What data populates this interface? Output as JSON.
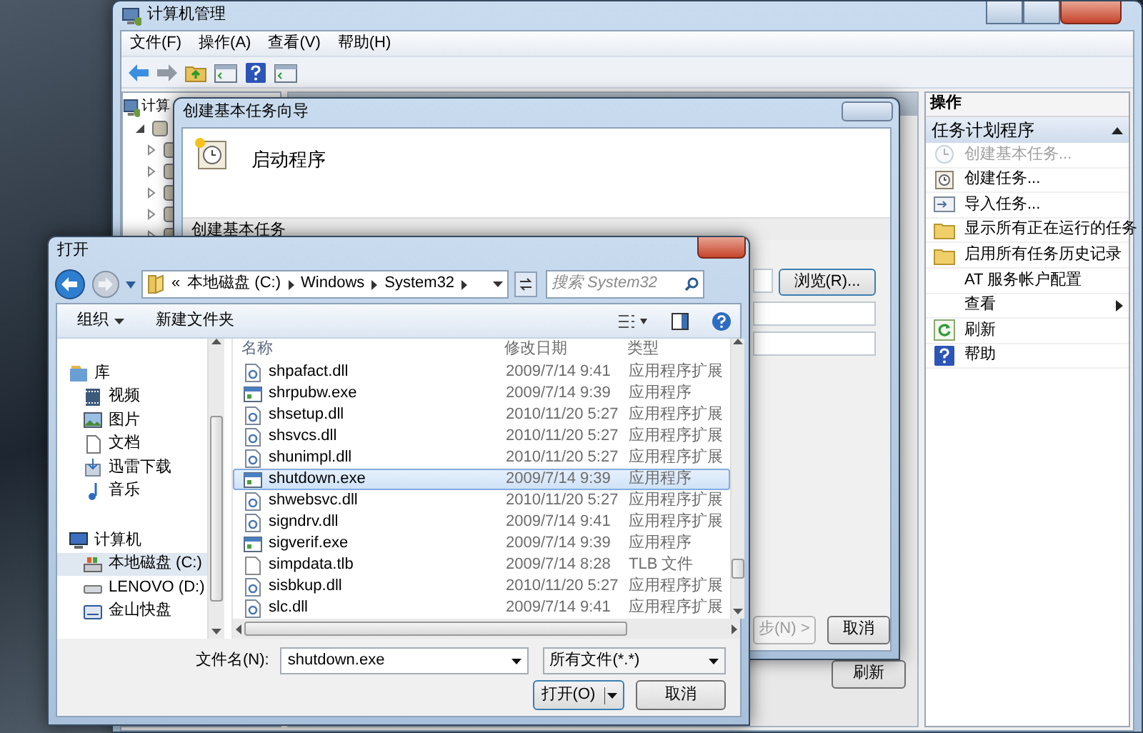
{
  "main_window": {
    "title": "计算机管理",
    "menu": [
      "文件(F)",
      "操作(A)",
      "查看(V)",
      "帮助(H)"
    ],
    "tree": {
      "label": "计算",
      "children": [
        {
          "expanded": true,
          "children": [
            {
              "expanded": false
            },
            {
              "expanded": false
            },
            {
              "expanded": false
            },
            {
              "expanded": false
            },
            {
              "expanded": false
            }
          ]
        }
      ]
    },
    "actions": {
      "title": "操作",
      "section": {
        "label": "任务计划程序",
        "expanded": true
      },
      "items": [
        {
          "label": "创建基本任务...",
          "disabled": true,
          "submenu": false
        },
        {
          "label": "创建任务...",
          "disabled": false,
          "submenu": false
        },
        {
          "label": "导入任务...",
          "disabled": false,
          "submenu": false
        },
        {
          "label": "显示所有正在运行的任务",
          "disabled": false,
          "submenu": false
        },
        {
          "label": "启用所有任务历史记录",
          "disabled": false,
          "submenu": false
        },
        {
          "label": "AT 服务帐户配置",
          "disabled": false,
          "submenu": false
        },
        {
          "label": "查看",
          "disabled": false,
          "submenu": true
        },
        {
          "label": "刷新",
          "disabled": false,
          "submenu": false
        },
        {
          "label": "帮助",
          "disabled": false,
          "submenu": false
        }
      ]
    },
    "refresh_button": "刷新"
  },
  "wizard": {
    "title": "创建基本任务向导",
    "heading": "启动程序",
    "step": "创建基本任务",
    "browse_button": "浏览(R)...",
    "next_button": {
      "label": "步(N) >",
      "disabled": true
    },
    "cancel_button": "取消"
  },
  "open_dialog": {
    "title": "打开",
    "path": {
      "overflow": "«",
      "crumbs": [
        "本地磁盘 (C:)",
        "Windows",
        "System32"
      ]
    },
    "search": {
      "placeholder": "搜索 System32"
    },
    "toolbar": [
      {
        "label": "组织",
        "dropdown": true
      },
      {
        "label": "新建文件夹",
        "dropdown": false
      }
    ],
    "nav": [
      {
        "label": "库",
        "selected": false,
        "children": [
          {
            "label": "视频",
            "selected": false
          },
          {
            "label": "图片",
            "selected": false
          },
          {
            "label": "文档",
            "selected": false
          },
          {
            "label": "迅雷下载",
            "selected": false
          },
          {
            "label": "音乐",
            "selected": false
          }
        ]
      },
      {
        "label": "计算机",
        "selected": false,
        "children": [
          {
            "label": "本地磁盘 (C:)",
            "selected": true
          },
          {
            "label": "LENOVO (D:)",
            "selected": false
          },
          {
            "label": "金山快盘",
            "selected": false
          }
        ]
      }
    ],
    "columns": [
      "名称",
      "修改日期",
      "类型"
    ],
    "files": [
      {
        "name": "shpafact.dll",
        "modified": "2009/7/14 9:41",
        "type": "应用程序扩展",
        "kind": "library",
        "selected": false
      },
      {
        "name": "shrpubw.exe",
        "modified": "2009/7/14 9:39",
        "type": "应用程序",
        "kind": "program",
        "selected": false
      },
      {
        "name": "shsetup.dll",
        "modified": "2010/11/20 5:27",
        "type": "应用程序扩展",
        "kind": "library",
        "selected": false
      },
      {
        "name": "shsvcs.dll",
        "modified": "2010/11/20 5:27",
        "type": "应用程序扩展",
        "kind": "library",
        "selected": false
      },
      {
        "name": "shunimpl.dll",
        "modified": "2010/11/20 5:27",
        "type": "应用程序扩展",
        "kind": "library",
        "selected": false
      },
      {
        "name": "shutdown.exe",
        "modified": "2009/7/14 9:39",
        "type": "应用程序",
        "kind": "program",
        "selected": true
      },
      {
        "name": "shwebsvc.dll",
        "modified": "2010/11/20 5:27",
        "type": "应用程序扩展",
        "kind": "library",
        "selected": false
      },
      {
        "name": "signdrv.dll",
        "modified": "2009/7/14 9:41",
        "type": "应用程序扩展",
        "kind": "library",
        "selected": false
      },
      {
        "name": "sigverif.exe",
        "modified": "2009/7/14 9:39",
        "type": "应用程序",
        "kind": "program",
        "selected": false
      },
      {
        "name": "simpdata.tlb",
        "modified": "2009/7/14 8:28",
        "type": "TLB 文件",
        "kind": "file",
        "selected": false
      },
      {
        "name": "sisbkup.dll",
        "modified": "2010/11/20 5:27",
        "type": "应用程序扩展",
        "kind": "library",
        "selected": false
      },
      {
        "name": "slc.dll",
        "modified": "2009/7/14 9:41",
        "type": "应用程序扩展",
        "kind": "library",
        "selected": false
      }
    ],
    "file_name": {
      "label": "文件名(N):",
      "value": "shutdown.exe"
    },
    "file_type": "所有文件(*.*)",
    "buttons": [
      {
        "label": "打开(O)",
        "kind": "split"
      },
      {
        "label": "取消",
        "kind": "plain"
      }
    ]
  }
}
